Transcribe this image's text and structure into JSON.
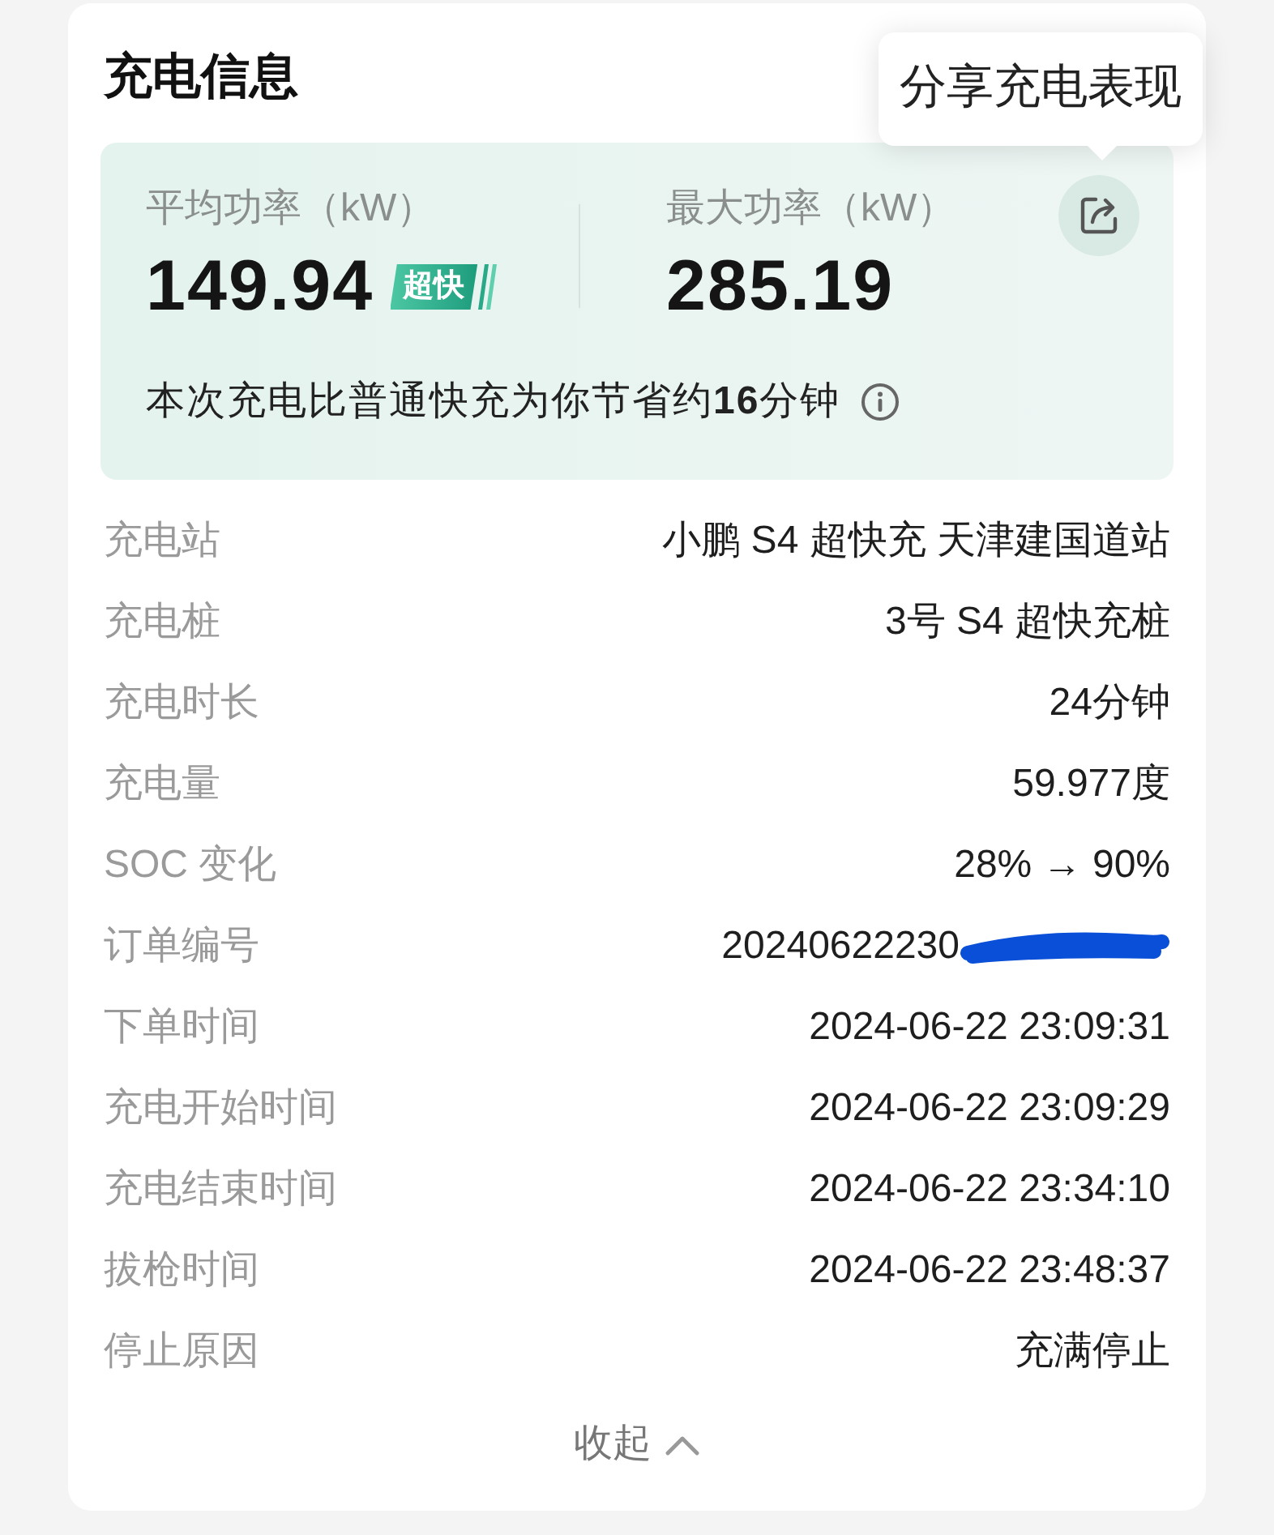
{
  "card": {
    "title": "充电信息"
  },
  "tooltip": {
    "text": "分享充电表现"
  },
  "summary": {
    "stats": [
      {
        "label": "平均功率（kW）",
        "value": "149.94",
        "badge": "超快"
      },
      {
        "label": "最大功率（kW）",
        "value": "285.19"
      }
    ],
    "savings_note": "本次充电比普通快充为你节省约**16**分钟"
  },
  "details": [
    {
      "label": "充电站",
      "value": "小鹏 S4 超快充 天津建国道站",
      "redacted": false
    },
    {
      "label": "充电桩",
      "value": "3号 S4 超快充桩",
      "redacted": false
    },
    {
      "label": "充电时长",
      "value": "24分钟",
      "redacted": false
    },
    {
      "label": "充电量",
      "value": "59.977度",
      "redacted": false
    },
    {
      "label": "SOC 变化",
      "value": "28% → 90%",
      "redacted": false
    },
    {
      "label": "订单编号",
      "value": "20240622230",
      "redacted": true
    },
    {
      "label": "下单时间",
      "value": "2024-06-22 23:09:31",
      "redacted": false
    },
    {
      "label": "充电开始时间",
      "value": "2024-06-22 23:09:29",
      "redacted": false
    },
    {
      "label": "充电结束时间",
      "value": "2024-06-22 23:34:10",
      "redacted": false
    },
    {
      "label": "拔枪时间",
      "value": "2024-06-22 23:48:37",
      "redacted": false
    },
    {
      "label": "停止原因",
      "value": "充满停止",
      "redacted": false
    }
  ],
  "collapse_link": {
    "label": "收起"
  }
}
